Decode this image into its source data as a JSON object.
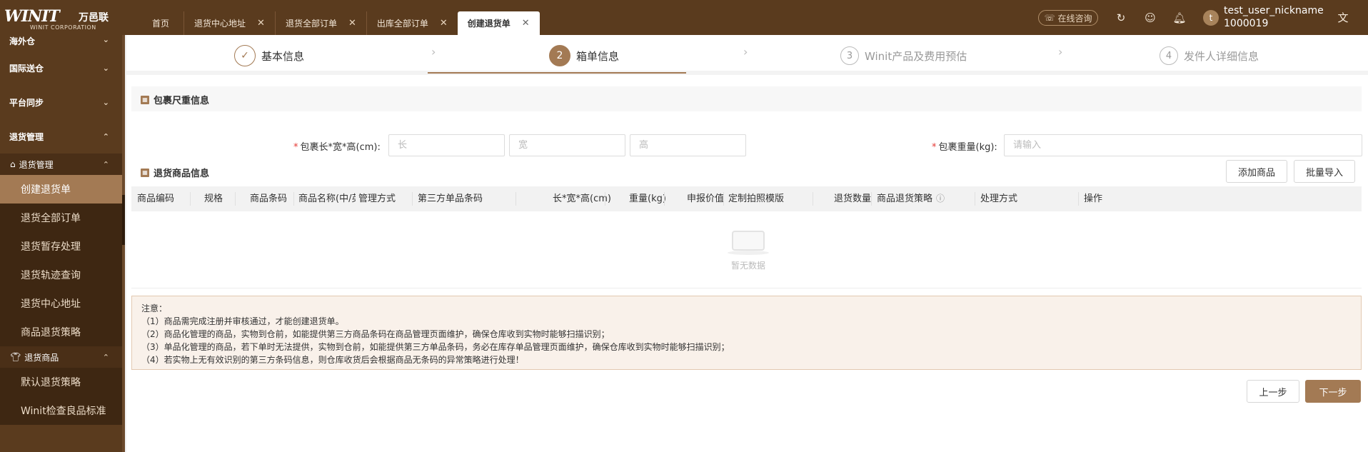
{
  "brand": {
    "mark": "WINIT",
    "cn": "万邑联",
    "en": "WINIT CORPORATION"
  },
  "tabs": [
    {
      "label": "首页",
      "closable": false
    },
    {
      "label": "退货中心地址",
      "closable": true
    },
    {
      "label": "退货全部订单",
      "closable": true
    },
    {
      "label": "出库全部订单",
      "closable": true
    },
    {
      "label": "创建退货单",
      "closable": true,
      "active": true
    }
  ],
  "header": {
    "consult_label": "在线咨询",
    "icons": [
      "refresh-icon",
      "feedback-icon",
      "bell-icon",
      "translate-icon"
    ],
    "avatar_letter": "t",
    "user_name": "test_user_nickname",
    "user_id": "1000019"
  },
  "sidebar": {
    "groups": [
      "海外仓",
      "国际送仓",
      "平台同步",
      "退货管理"
    ],
    "sub1": {
      "label": "退货管理",
      "icon": "home-icon"
    },
    "items1": [
      "创建退货单",
      "退货全部订单",
      "退货暂存处理",
      "退货轨迹查询",
      "退货中心地址",
      "商品退货策略"
    ],
    "sub2": {
      "label": "退货商品",
      "icon": "shirt-icon"
    },
    "items2": [
      "默认退货策略",
      "Winit检查良品标准"
    ]
  },
  "steps": [
    {
      "num": "✓",
      "label": "基本信息",
      "state": "done"
    },
    {
      "num": "2",
      "label": "箱单信息",
      "state": "active"
    },
    {
      "num": "3",
      "label": "Winit产品及费用预估",
      "state": "todo"
    },
    {
      "num": "4",
      "label": "发件人详细信息",
      "state": "todo"
    }
  ],
  "parcel": {
    "title": "包裹尺重信息",
    "size_label": "包裹长*宽*高(cm):",
    "length_placeholder": "长",
    "width_placeholder": "宽",
    "height_placeholder": "高",
    "weight_label": "包裹重量(kg):",
    "weight_placeholder": "请输入"
  },
  "goods": {
    "title": "退货商品信息",
    "add_button": "添加商品",
    "import_button": "批量导入",
    "columns": [
      "商品编码",
      "规格",
      "商品条码",
      "商品名称(中/英",
      "管理方式",
      "第三方单品条码",
      "长*宽*高(cm)",
      "重量(kg)",
      "申报价值",
      "定制拍照模版",
      "退货数量",
      "商品退货策略",
      "处理方式",
      "操作"
    ],
    "empty_text": "暂无数据"
  },
  "note": {
    "title": "注意：",
    "lines": [
      "（1）商品需完成注册并审核通过，才能创建退货单。",
      "（2）商品化管理的商品，实物到仓前，如能提供第三方商品条码在商品管理页面维护，确保仓库收到实物时能够扫描识别；",
      "（3）单品化管理的商品，若下单时无法提供，实物到仓前，如能提供第三方单品条码，务必在库存单品管理页面维护，确保仓库收到实物时能够扫描识别；",
      "（4）若实物上无有效识别的第三方条码信息，则仓库收货后会根据商品无条码的异常策略进行处理！"
    ]
  },
  "footer": {
    "prev_label": "上一步",
    "next_label": "下一步"
  },
  "colors": {
    "brand_dark": "#5a3b1e",
    "accent": "#a37a54"
  }
}
